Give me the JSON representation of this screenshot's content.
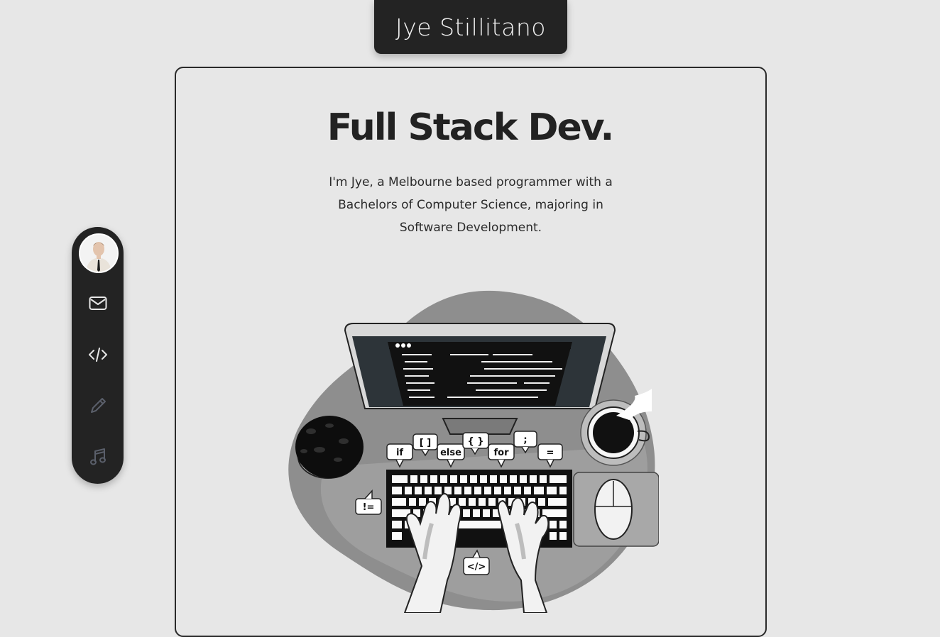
{
  "header": {
    "name": "Jye Stillitano"
  },
  "hero": {
    "headline": "Full Stack Dev.",
    "intro": "I'm Jye, a Melbourne based programmer with a Bachelors of Computer Science, majoring in Software Development."
  },
  "sidebar": {
    "items": [
      {
        "icon": "avatar",
        "label": ""
      },
      {
        "icon": "mail-icon",
        "active": true
      },
      {
        "icon": "code-icon",
        "active": true
      },
      {
        "icon": "pencil-icon",
        "active": false
      },
      {
        "icon": "music-icon",
        "active": false
      }
    ]
  },
  "illustration": {
    "bubbles": [
      "if",
      "[ ]",
      "else",
      "{ }",
      "for",
      ";",
      "=",
      "!=",
      "</>"
    ]
  },
  "colors": {
    "background": "#e7e7e7",
    "dark": "#232323",
    "inactive_icon": "#5a5f6a",
    "active_icon": "#e8e8e8"
  }
}
